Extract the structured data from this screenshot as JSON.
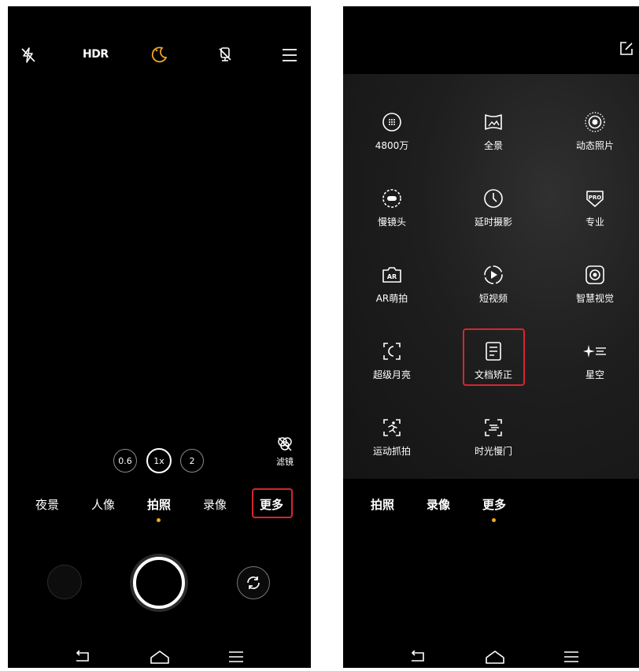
{
  "left_screen": {
    "topbar": {
      "flash_icon": "flash-off-icon",
      "hdr_label": "HDR",
      "night_icon": "moon-icon",
      "colors": {
        "night_icon": "#f5a623"
      },
      "mic_icon": "mic-off-icon",
      "menu_icon": "hamburger-menu-icon"
    },
    "zoom": {
      "options": [
        "0.6",
        "1x",
        "2"
      ],
      "selected": "1x"
    },
    "filter": {
      "icon": "filter-icon",
      "label": "滤镜"
    },
    "modes": [
      {
        "label": "夜景"
      },
      {
        "label": "人像"
      },
      {
        "label": "拍照",
        "active": true
      },
      {
        "label": "录像"
      },
      {
        "label": "更多",
        "highlighted": true
      }
    ],
    "controls": {
      "gallery_thumb": "gallery-thumbnail",
      "shutter": "shutter-button",
      "switch_camera_icon": "switch-camera-icon"
    },
    "nav": [
      "back-icon",
      "home-icon",
      "recent-apps-icon"
    ]
  },
  "right_screen": {
    "topbar": {
      "edit_icon": "edit-icon"
    },
    "grid": [
      {
        "label": "4800万",
        "icon": "megapixel-icon"
      },
      {
        "label": "全景",
        "icon": "panorama-icon"
      },
      {
        "label": "动态照片",
        "icon": "live-photo-icon"
      },
      {
        "label": "慢镜头",
        "icon": "slow-motion-icon"
      },
      {
        "label": "延时摄影",
        "icon": "timelapse-icon"
      },
      {
        "label": "专业",
        "icon": "pro-mode-icon"
      },
      {
        "label": "AR萌拍",
        "icon": "ar-icon"
      },
      {
        "label": "短视频",
        "icon": "short-video-icon"
      },
      {
        "label": "智慧视觉",
        "icon": "smart-vision-icon"
      },
      {
        "label": "超级月亮",
        "icon": "super-moon-icon"
      },
      {
        "label": "文档矫正",
        "icon": "document-icon",
        "highlighted": true
      },
      {
        "label": "星空",
        "icon": "starry-sky-icon"
      },
      {
        "label": "运动抓拍",
        "icon": "sport-capture-icon"
      },
      {
        "label": "时光慢门",
        "icon": "slow-shutter-icon"
      }
    ],
    "modes": [
      {
        "label": "拍照"
      },
      {
        "label": "录像"
      },
      {
        "label": "更多",
        "active": true
      }
    ],
    "nav": [
      "back-icon",
      "home-icon",
      "recent-apps-icon"
    ]
  },
  "colors": {
    "accent": "#f5a623",
    "highlight": "#d6262f",
    "background": "#000000"
  }
}
